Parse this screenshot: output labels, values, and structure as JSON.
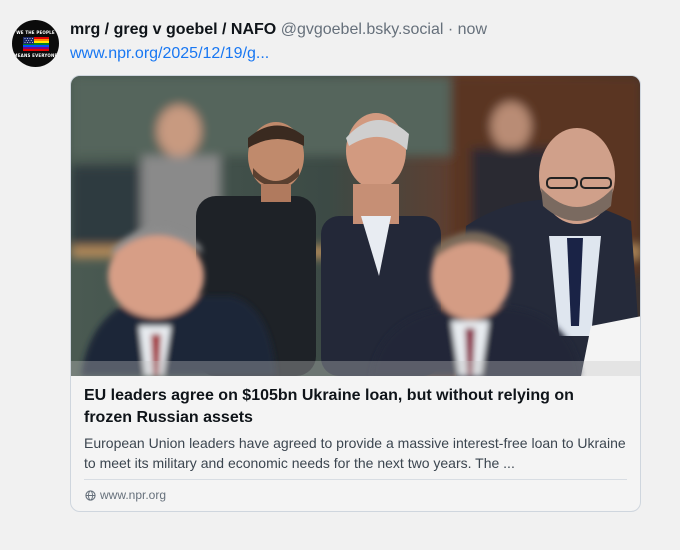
{
  "post": {
    "display_name": "mrg / greg v goebel / NAFO",
    "handle": "@gvgoebel.bsky.social",
    "separator": "·",
    "time": "now",
    "link_text": "www.npr.org/2025/12/19/g..."
  },
  "avatar": {
    "text_top": "WE THE PEOPLE",
    "text_bottom": "MEANS EVERYONE"
  },
  "card": {
    "title": "EU leaders agree on $105bn Ukraine loan, but without relying on frozen Russian assets",
    "description": "European Union leaders have agreed to provide a massive interest-free loan to Ukraine to meet its military and economic needs for the next two years. The ...",
    "domain": "www.npr.org",
    "image_icon": "news-photo"
  },
  "colors": {
    "link": "#1877f2",
    "muted": "#66707b",
    "background": "#f1f1f1"
  }
}
